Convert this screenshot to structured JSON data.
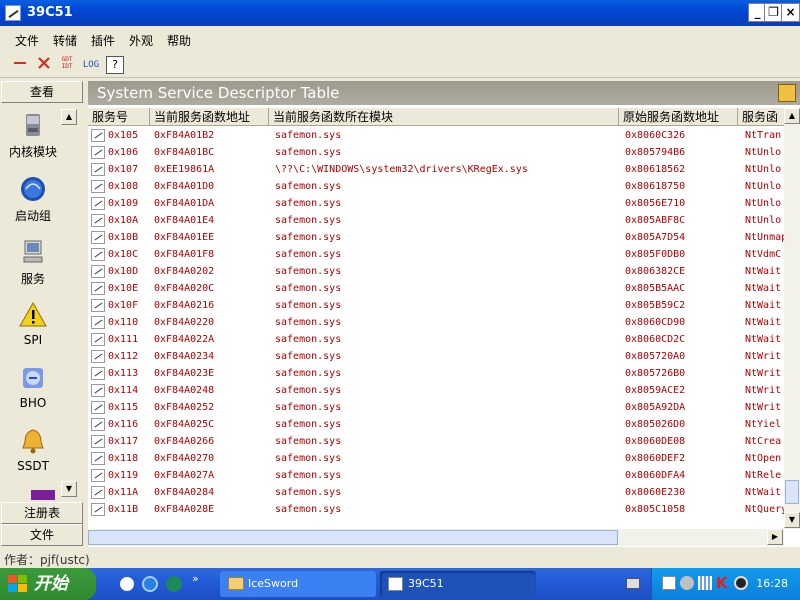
{
  "window": {
    "title": "39C51"
  },
  "title_buttons": {
    "min": "_",
    "restore": "❐",
    "close": "×"
  },
  "menu": [
    "文件",
    "转储",
    "插件",
    "外观",
    "帮助"
  ],
  "toolbar": {
    "gdt_idt": "GDT\nIDT",
    "log": "LOG",
    "help": "?"
  },
  "sidebar": {
    "header": "查看",
    "items": [
      "内核模块",
      "启动组",
      "服务",
      "SPI",
      "BHO",
      "SSDT"
    ],
    "footer": [
      "注册表",
      "文件"
    ]
  },
  "panel": {
    "title": "System Service Descriptor Table"
  },
  "table": {
    "columns": [
      "服务号",
      "当前服务函数地址",
      "当前服务函数所在模块",
      "原始服务函数地址",
      "服务函"
    ],
    "rows": [
      [
        "0x105",
        "0xF84A01B2",
        "safemon.sys",
        "0x8060C326",
        "NtTran"
      ],
      [
        "0x106",
        "0xF84A01BC",
        "safemon.sys",
        "0x805794B6",
        "NtUnlo"
      ],
      [
        "0x107",
        "0xEE19861A",
        "\\??\\C:\\WINDOWS\\system32\\drivers\\KRegEx.sys",
        "0x80618562",
        "NtUnlo"
      ],
      [
        "0x108",
        "0xF84A01D0",
        "safemon.sys",
        "0x80618750",
        "NtUnlo"
      ],
      [
        "0x109",
        "0xF84A01DA",
        "safemon.sys",
        "0x8056E710",
        "NtUnlo"
      ],
      [
        "0x10A",
        "0xF84A01E4",
        "safemon.sys",
        "0x805ABF8C",
        "NtUnlo"
      ],
      [
        "0x10B",
        "0xF84A01EE",
        "safemon.sys",
        "0x805A7D54",
        "NtUnmap"
      ],
      [
        "0x10C",
        "0xF84A01F8",
        "safemon.sys",
        "0x805F0DB0",
        "NtVdmC"
      ],
      [
        "0x10D",
        "0xF84A0202",
        "safemon.sys",
        "0x806382CE",
        "NtWait"
      ],
      [
        "0x10E",
        "0xF84A020C",
        "safemon.sys",
        "0x805B5AAC",
        "NtWait"
      ],
      [
        "0x10F",
        "0xF84A0216",
        "safemon.sys",
        "0x805B59C2",
        "NtWait"
      ],
      [
        "0x110",
        "0xF84A0220",
        "safemon.sys",
        "0x8060CD90",
        "NtWait"
      ],
      [
        "0x111",
        "0xF84A022A",
        "safemon.sys",
        "0x8060CD2C",
        "NtWait"
      ],
      [
        "0x112",
        "0xF84A0234",
        "safemon.sys",
        "0x805720A0",
        "NtWrit"
      ],
      [
        "0x113",
        "0xF84A023E",
        "safemon.sys",
        "0x805726B0",
        "NtWrit"
      ],
      [
        "0x114",
        "0xF84A0248",
        "safemon.sys",
        "0x8059ACE2",
        "NtWrit"
      ],
      [
        "0x115",
        "0xF84A0252",
        "safemon.sys",
        "0x805A92DA",
        "NtWrit"
      ],
      [
        "0x116",
        "0xF84A025C",
        "safemon.sys",
        "0x805026D0",
        "NtYiel"
      ],
      [
        "0x117",
        "0xF84A0266",
        "safemon.sys",
        "0x8060DE08",
        "NtCrea"
      ],
      [
        "0x118",
        "0xF84A0270",
        "safemon.sys",
        "0x8060DEF2",
        "NtOpen"
      ],
      [
        "0x119",
        "0xF84A027A",
        "safemon.sys",
        "0x8060DFA4",
        "NtRele"
      ],
      [
        "0x11A",
        "0xF84A0284",
        "safemon.sys",
        "0x8060E230",
        "NtWait"
      ],
      [
        "0x11B",
        "0xF84A028E",
        "safemon.sys",
        "0x805C1058",
        "NtQuery"
      ]
    ]
  },
  "status": {
    "author": "作者：pjf(ustc)"
  },
  "taskbar": {
    "start": "开始",
    "tasks": [
      "IceSword",
      "39C51"
    ],
    "clock": "16:28"
  }
}
